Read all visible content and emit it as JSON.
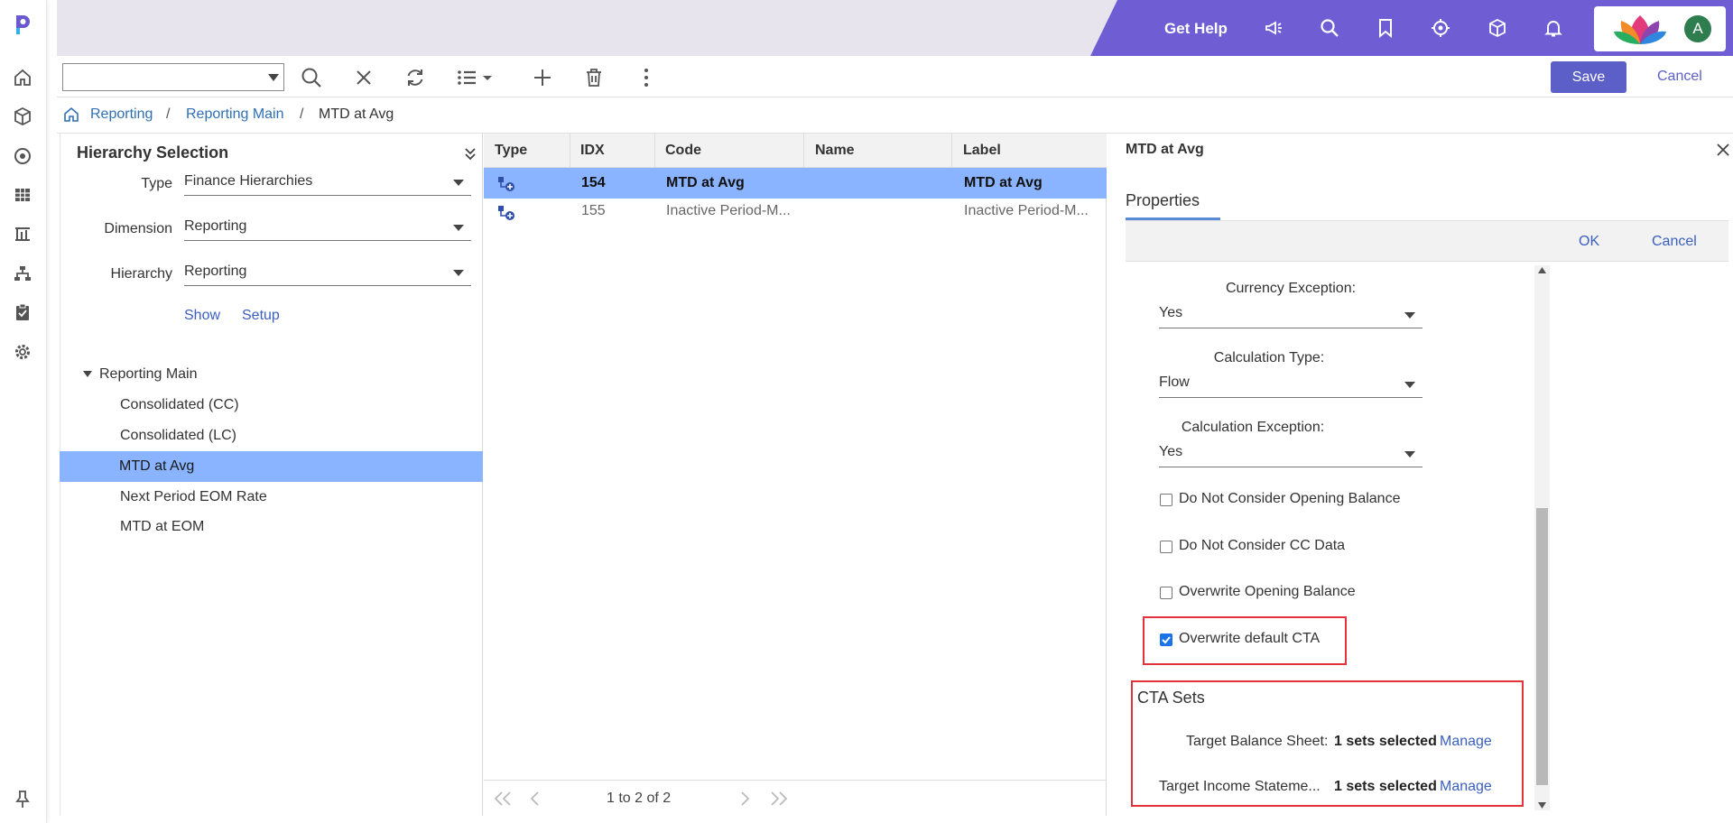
{
  "header": {
    "get_help": "Get Help",
    "avatar_initial": "A",
    "accent_color": "#6a5acd"
  },
  "toolbar": {
    "combo_value": "",
    "save_label": "Save",
    "cancel_label": "Cancel"
  },
  "breadcrumb": {
    "items": [
      "Reporting",
      "Reporting Main",
      "MTD at Avg"
    ],
    "separator": "/"
  },
  "hierarchy": {
    "title": "Hierarchy Selection",
    "type_label": "Type",
    "type_value": "Finance Hierarchies",
    "dimension_label": "Dimension",
    "dimension_value": "Reporting",
    "hierarchy_label": "Hierarchy",
    "hierarchy_value": "Reporting",
    "show_link": "Show",
    "setup_link": "Setup",
    "tree": {
      "root": "Reporting Main",
      "children": [
        "Consolidated (CC)",
        "Consolidated (LC)",
        "MTD at Avg",
        "Next Period EOM Rate",
        "MTD at EOM"
      ],
      "selected_index": 2
    }
  },
  "grid": {
    "columns": [
      "Type",
      "IDX",
      "Code",
      "Name",
      "Label"
    ],
    "rows": [
      {
        "idx": "154",
        "code": "MTD at Avg",
        "name": "",
        "label": "MTD at Avg"
      },
      {
        "idx": "155",
        "code": "Inactive Period-M...",
        "name": "",
        "label": "Inactive Period-M..."
      }
    ],
    "pager_text": "1 to 2 of 2"
  },
  "details": {
    "title": "MTD at Avg",
    "tab": "Properties",
    "ok_label": "OK",
    "cancel_label": "Cancel",
    "currency_exception_label": "Currency Exception:",
    "currency_exception_value": "Yes",
    "calculation_type_label": "Calculation Type:",
    "calculation_type_value": "Flow",
    "calculation_exception_label": "Calculation Exception:",
    "calculation_exception_value": "Yes",
    "checkboxes": [
      {
        "label": "Do Not Consider Opening Balance",
        "checked": false
      },
      {
        "label": "Do Not Consider CC Data",
        "checked": false
      },
      {
        "label": "Overwrite Opening Balance",
        "checked": false
      },
      {
        "label": "Overwrite default CTA",
        "checked": true
      }
    ],
    "cta_sets_title": "CTA Sets",
    "target_bs_label": "Target Balance Sheet:",
    "target_bs_value": "1 sets selected",
    "target_is_label": "Target Income Stateme...",
    "target_is_value": "1 sets selected",
    "manage_label": "Manage"
  }
}
